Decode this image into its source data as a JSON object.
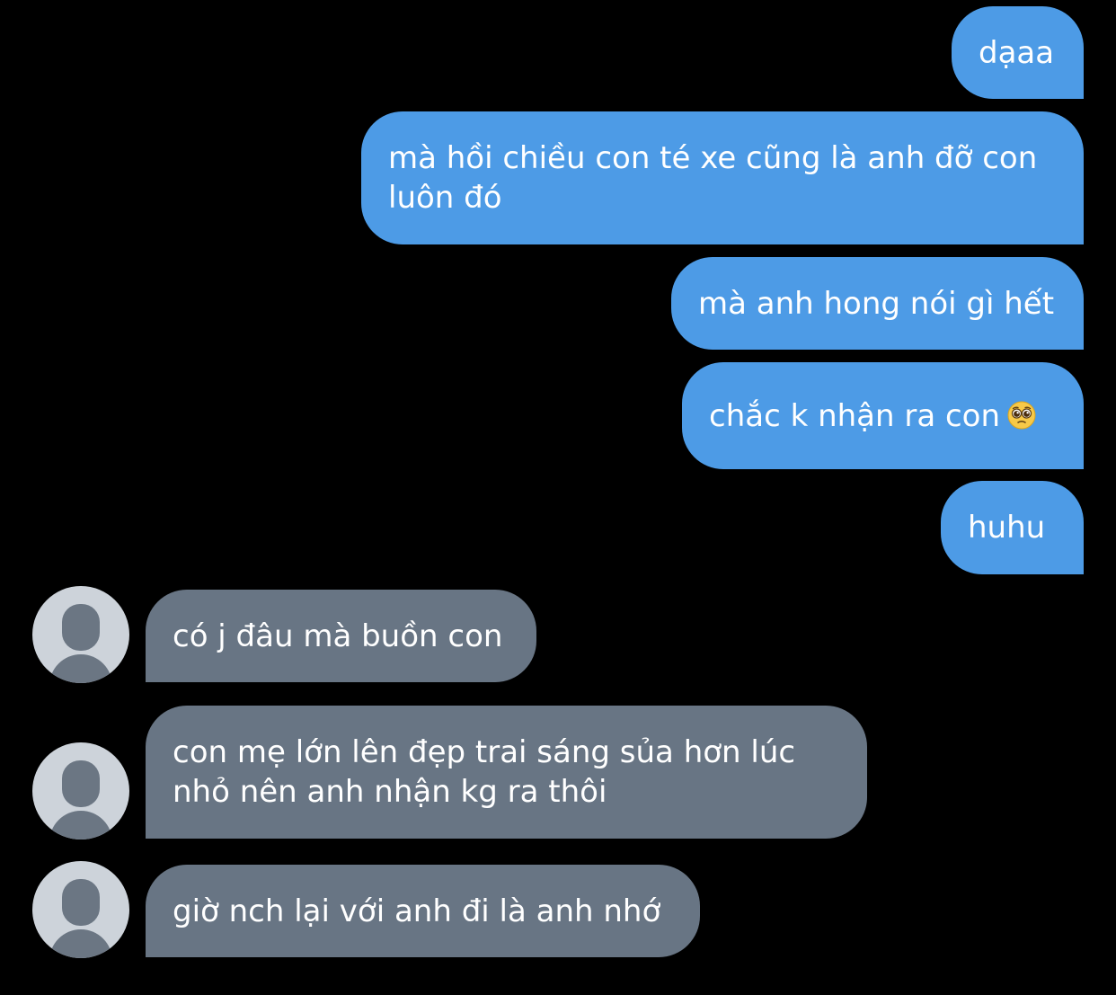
{
  "messages": {
    "outgoing": [
      {
        "text": "dạaa"
      },
      {
        "text": "mà hồi chiều con té xe cũng là anh đỡ con luôn đó"
      },
      {
        "text": "mà anh hong nói gì hết"
      },
      {
        "text": "chắc k nhận ra con",
        "emoji": "pleading-face-icon"
      },
      {
        "text": "huhu"
      }
    ],
    "incoming": [
      {
        "text": "có j đâu mà buồn con"
      },
      {
        "text": "con mẹ lớn lên đẹp trai sáng sủa hơn lúc nhỏ nên anh nhận kg ra thôi"
      },
      {
        "text": "giờ nch lại với anh đi là anh nhớ"
      }
    ]
  },
  "colors": {
    "background": "#000000",
    "outgoing_bubble": "#4d9be6",
    "incoming_bubble": "#687584",
    "avatar_bg": "#cdd3da",
    "avatar_figure": "#6b7683"
  }
}
